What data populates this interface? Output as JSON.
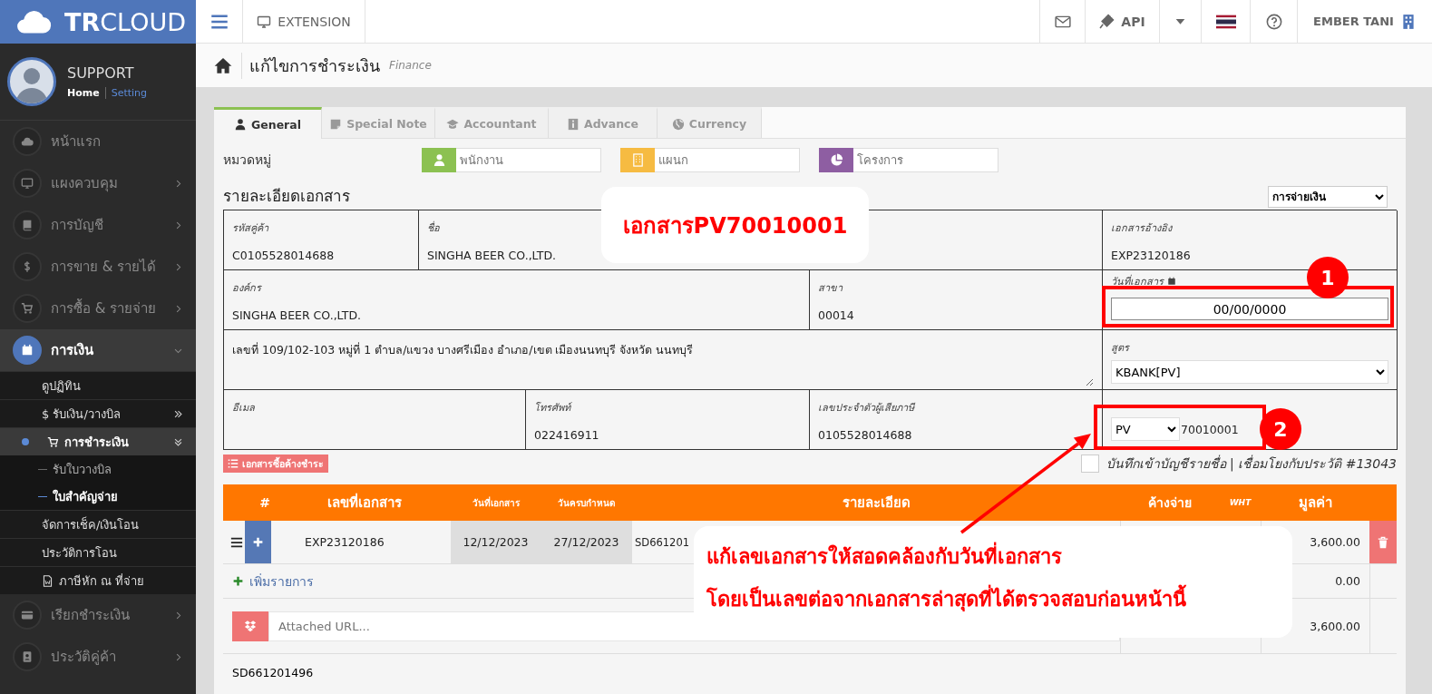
{
  "brand": "**TR**CLOUD",
  "user": {
    "name": "SUPPORT",
    "links": [
      {
        "label": "Home",
        "selected": true
      },
      {
        "label": "Setting",
        "selected": false
      }
    ]
  },
  "sidebar": {
    "items": [
      {
        "label": "หน้าแรก",
        "kind": "link",
        "expanded": false
      },
      {
        "label": "แผงควบคุม",
        "kind": "menu",
        "expanded": false
      },
      {
        "label": "การบัญชี",
        "kind": "menu",
        "expanded": false
      },
      {
        "label": "การขาย & รายได้",
        "kind": "menu",
        "expanded": false
      },
      {
        "label": "การซื้อ & รายจ่าย",
        "kind": "menu",
        "expanded": false
      },
      {
        "label": "การเงิน",
        "kind": "menu",
        "expanded": true,
        "children": [
          {
            "label": "ดูปฏิทิน",
            "kind": "link",
            "expanded": false
          },
          {
            "label": "$ รับเงิน/วางบิล",
            "kind": "menu",
            "expanded": false
          },
          {
            "label": "การชำระเงิน",
            "kind": "menu",
            "expanded": true,
            "children": [
              {
                "label": "รับใบวางบิล",
                "selected": false
              },
              {
                "label": "ใบสำคัญจ่าย",
                "selected": true
              }
            ]
          },
          {
            "label": "จัดการเช็ค/เงินโอน",
            "kind": "link",
            "expanded": false
          },
          {
            "label": "ประวัติการโอน",
            "kind": "link",
            "expanded": false
          },
          {
            "label": "ภาษีหัก ณ ที่จ่าย",
            "kind": "link",
            "expanded": false
          }
        ]
      },
      {
        "label": "เรียกชำระเงิน",
        "kind": "menu",
        "expanded": false
      },
      {
        "label": "ประวัติคู่ค้า",
        "kind": "menu",
        "expanded": false
      }
    ]
  },
  "topbar": {
    "extension": "EXTENSION",
    "api": "API",
    "user": "EMBER TANI"
  },
  "page": {
    "title": "แก้ไขการชำระเงิน",
    "subtitle": "Finance"
  },
  "tabs": [
    {
      "label": "General",
      "selected": true
    },
    {
      "label": "Special Note",
      "selected": false
    },
    {
      "label": "Accountant",
      "selected": false
    },
    {
      "label": "Advance",
      "selected": false
    },
    {
      "label": "Currency",
      "selected": false
    }
  ],
  "category": {
    "label": "หมวดหมู่",
    "fields": [
      {
        "placeholder": "พนักงาน",
        "color": "#8cc152"
      },
      {
        "placeholder": "แผนก",
        "color": "#f6bb42"
      },
      {
        "placeholder": "โครงการ",
        "color": "#8e5ea2"
      }
    ]
  },
  "details": {
    "title": "รายละเอียดเอกสาร",
    "doc_type": "การจ่ายเงิน",
    "fields": [
      {
        "kind": "text",
        "label": "รหัสคู่ค้า",
        "value": "C0105528014688"
      },
      {
        "kind": "text",
        "label": "ชื่อ",
        "value": "SINGHA BEER CO.,LTD."
      },
      {
        "kind": "text",
        "label": "เอกสารอ้างอิง",
        "value": "EXP23120186"
      },
      {
        "kind": "text",
        "label": "องค์กร",
        "value": "SINGHA BEER CO.,LTD."
      },
      {
        "kind": "text",
        "label": "สาขา",
        "value": "00014"
      },
      {
        "kind": "date",
        "label": "วันที่เอกสาร",
        "value": "00/00/0000"
      },
      {
        "kind": "textarea",
        "value": "เลขที่ 109/102-103 หมู่ที่ 1 ตำบล/แขวง บางศรีเมือง อำเภอ/เขต เมืองนนทบุรี จังหวัด นนทบุรี"
      },
      {
        "kind": "select",
        "label": "สูตร",
        "value": "KBANK[PV]"
      },
      {
        "kind": "text",
        "label": "อีเมล"
      },
      {
        "kind": "text",
        "label": "โทรศัพท์",
        "value": "022416911"
      },
      {
        "kind": "text",
        "label": "เลขประจำตัวผู้เสียภาษี",
        "value": "0105528014688"
      },
      {
        "kind": "doc_number",
        "prefix": "PV",
        "value": "70010001"
      }
    ]
  },
  "outstanding_button": "เอกสารซื้อค้างชำระ",
  "save_contact": {
    "checked": false,
    "label": "บันทึกเข้าบัญชีรายชื่อ | เชื่อมโยงกับประวัติ #13043"
  },
  "items_table": {
    "columns": [
      "#",
      "เลขที่เอกสาร",
      "วันที่เอกสาร",
      "วันครบกำหนด",
      "รายละเอียด",
      "ค้างจ่าย",
      "WHT",
      "มูลค่า"
    ],
    "rows": [
      {
        "doc_no": "EXP23120186",
        "date": "12/12/2023",
        "due": "27/12/2023",
        "detail": "SD661201",
        "value": "3,600.00"
      }
    ],
    "add_label": "เพิ่มรายการ",
    "subtotal": "0.00",
    "attachment_placeholder": "Attached URL...",
    "total": "3,600.00",
    "note": "SD661201496"
  },
  "annotations": {
    "title_callout": "เอกสารPV70010001",
    "markers": [
      "1",
      "2"
    ],
    "note_callout": [
      "แก้เลขเอกสารให้สอดคล้องกับวันที่เอกสาร",
      "โดยเป็นเลขต่อจากเอกสารล่าสุดที่ได้ตรวจสอบก่อนหน้านี้"
    ]
  }
}
